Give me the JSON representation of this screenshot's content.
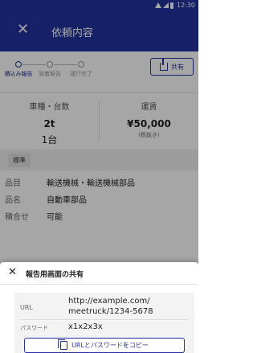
{
  "status_bar": {
    "time": "12:30"
  },
  "app_bar": {
    "close_icon": "close-icon",
    "title": "依頼内容"
  },
  "stepper": {
    "steps": [
      {
        "label": "積込み報告",
        "active": true
      },
      {
        "label": "到着報告",
        "active": false
      },
      {
        "label": "運行完了",
        "active": false
      }
    ],
    "share_label": "共有",
    "share_icon": "share-icon"
  },
  "summary": {
    "vehicle_header": "車種・台数",
    "vehicle_type": "2t",
    "vehicle_count": "1台",
    "fare_header": "運賃",
    "fare_amount": "¥50,000",
    "fare_note": "(税抜き)"
  },
  "tag": "標準",
  "details": [
    {
      "key": "品目",
      "value": "輸送機械・輸送機械部品"
    },
    {
      "key": "品名",
      "value": "自動車部品"
    },
    {
      "key": "積合せ",
      "value": "可能"
    }
  ],
  "sheet": {
    "title": "報告用画面の共有",
    "url_label": "URL",
    "url_line1": "http://example.com/",
    "url_line2": "meetruck/1234-5678",
    "password_label": "パスワード",
    "password": "x1x2x3x",
    "copy_button": "URLとパスワードをコピー",
    "copy_icon": "copy-icon"
  },
  "colors": {
    "brand": "#22339f",
    "scrim": "rgba(0,0,0,0.35)"
  }
}
